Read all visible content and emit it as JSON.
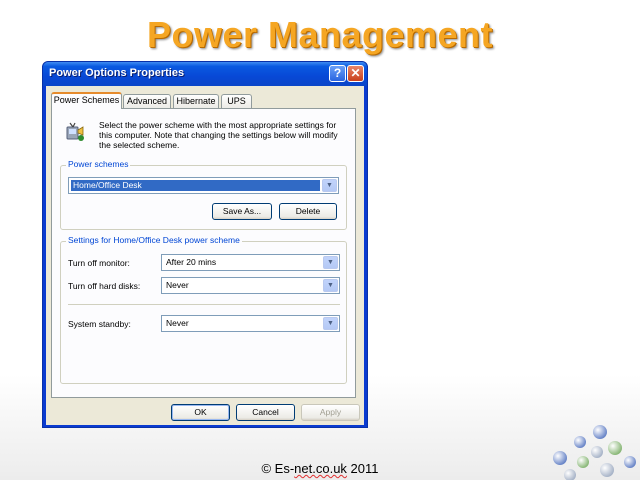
{
  "slide": {
    "title": "Power Management",
    "footer_prefix": "© Es-",
    "footer_domain": "net.co.uk",
    "footer_suffix": " 2011"
  },
  "dialog": {
    "title": "Power Options Properties",
    "help_glyph": "?",
    "close_glyph": "✕",
    "tabs": [
      {
        "label": "Power Schemes",
        "active": true
      },
      {
        "label": "Advanced"
      },
      {
        "label": "Hibernate"
      },
      {
        "label": "UPS"
      }
    ],
    "intro_text": "Select the power scheme with the most appropriate settings for this computer. Note that changing the settings below will modify the selected scheme.",
    "power_schemes": {
      "group_label": "Power schemes",
      "selected": "Home/Office Desk",
      "save_as_label": "Save As...",
      "delete_label": "Delete"
    },
    "settings": {
      "group_label": "Settings for Home/Office Desk power scheme",
      "monitor_label": "Turn off monitor:",
      "monitor_value": "After 20 mins",
      "disks_label": "Turn off hard disks:",
      "disks_value": "Never",
      "standby_label": "System standby:",
      "standby_value": "Never"
    },
    "buttons": {
      "ok": "OK",
      "cancel": "Cancel",
      "apply": "Apply"
    },
    "dropdown_glyph": "▼"
  },
  "colors": {
    "title_orange": "#f5a623",
    "xp_blue": "#0a5ae0",
    "group_label_blue": "#0046d5",
    "selection_blue": "#316ac5"
  }
}
